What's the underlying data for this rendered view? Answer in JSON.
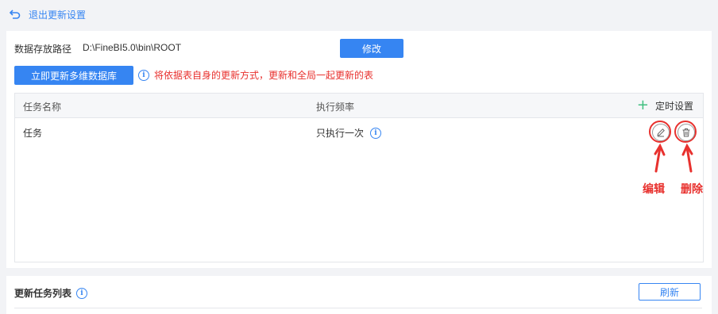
{
  "header": {
    "exit_label": "退出更新设置",
    "exit_icon": "undo-arrow-icon"
  },
  "settings": {
    "path_label": "数据存放路径",
    "path_value": "D:\\FineBI5.0\\bin\\ROOT",
    "modify_button": "修改",
    "update_now_button": "立即更新多维数据库",
    "tip_text": "将依据表自身的更新方式，更新和全局一起更新的表"
  },
  "task_table": {
    "columns": [
      "任务名称",
      "执行频率"
    ],
    "add_timer_label": "定时设置",
    "rows": [
      {
        "name": "任务",
        "frequency": "只执行一次"
      }
    ]
  },
  "annotations": {
    "edit_label": "编辑",
    "delete_label": "删除"
  },
  "update_list": {
    "title": "更新任务列表",
    "refresh_button": "刷新"
  },
  "colors": {
    "primary": "#3685f2",
    "warning_red": "#e8312e",
    "add_green": "#3fbf7f"
  }
}
